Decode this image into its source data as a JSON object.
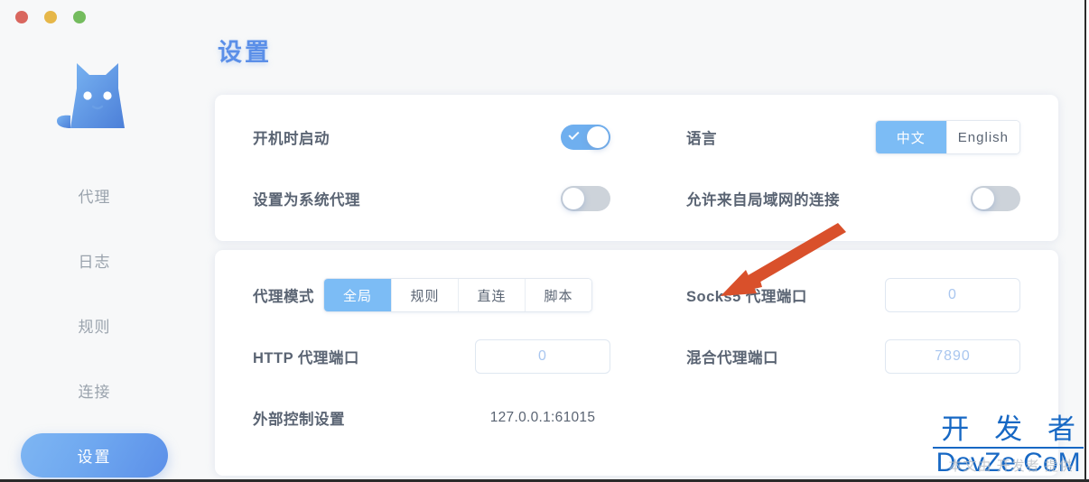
{
  "window": {
    "controls": [
      {
        "name": "close",
        "color": "#d9675f"
      },
      {
        "name": "minimize",
        "color": "#e6b749"
      },
      {
        "name": "maximize",
        "color": "#74bc5e"
      }
    ]
  },
  "sidebar": {
    "logo_alt": "cat-logo",
    "items": [
      {
        "label": "代理",
        "active": false
      },
      {
        "label": "日志",
        "active": false
      },
      {
        "label": "规则",
        "active": false
      },
      {
        "label": "连接",
        "active": false
      },
      {
        "label": "设置",
        "active": true
      }
    ]
  },
  "main": {
    "title": "设置",
    "general_card": {
      "startup": {
        "label": "开机时启动",
        "state": "on"
      },
      "language": {
        "label": "语言",
        "options": [
          "中文",
          "English"
        ],
        "selected": "中文"
      },
      "system_proxy": {
        "label": "设置为系统代理",
        "state": "off"
      },
      "allow_lan": {
        "label": "允许来自局域网的连接",
        "state": "off"
      }
    },
    "proxy_card": {
      "mode": {
        "label": "代理模式",
        "options": [
          "全局",
          "规则",
          "直连",
          "脚本"
        ],
        "selected": "全局"
      },
      "socks5_port": {
        "label": "Socks5 代理端口",
        "value": "0"
      },
      "http_port": {
        "label": "HTTP 代理端口",
        "value": "0"
      },
      "mixed_port": {
        "label": "混合代理端口",
        "value": "7890"
      },
      "external_control": {
        "label": "外部控制设置",
        "value": "127.0.0.1:61015"
      }
    }
  },
  "annotation": {
    "arrow_color": "#d9502b",
    "points_to": "Socks5 代理端口"
  },
  "watermark": {
    "cn": "开 发 者",
    "en": "DevZe.CoM",
    "ghost": "本文由 开发者 提供"
  },
  "colors": {
    "accent": "#5b8fe8",
    "toggle_on": "#6fafef",
    "toggle_off": "#cdd3da",
    "segment_active": "#7cbcf5",
    "page_bg": "#f7f8f9",
    "card_bg": "#ffffff",
    "label_text": "#5a6473",
    "input_text": "#a9c6ef"
  }
}
